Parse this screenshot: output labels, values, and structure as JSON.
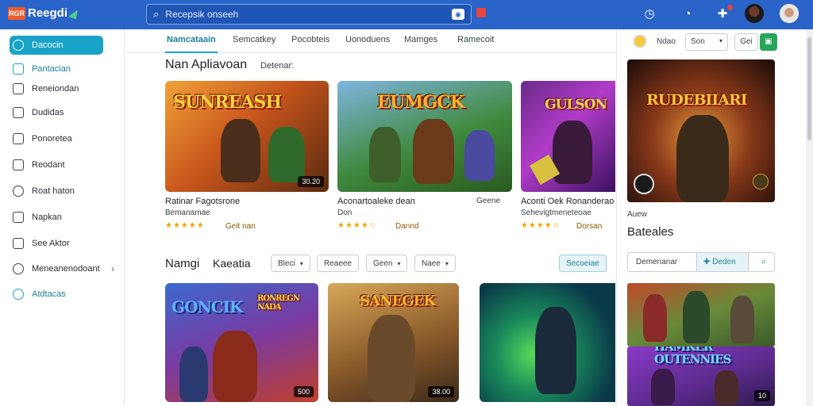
{
  "app": {
    "logo_mark": "RGR",
    "logo_text": "Reegdi"
  },
  "search": {
    "placeholder": "Recepsik onseeh"
  },
  "sidebar": {
    "items": [
      {
        "label": "Dacocin",
        "icon": "compass-icon"
      },
      {
        "label": "Pantacian",
        "icon": "grid-icon"
      },
      {
        "label": "Reneiondan",
        "icon": "document-icon"
      },
      {
        "label": "Dudidas",
        "icon": "list-icon"
      },
      {
        "label": "Ponoretea",
        "icon": "folder-icon"
      },
      {
        "label": "Reodant",
        "icon": "bookmark-icon"
      },
      {
        "label": "Roat haton",
        "icon": "settings-icon"
      },
      {
        "label": "Napkan",
        "icon": "edit-icon"
      },
      {
        "label": "See Aktor",
        "icon": "share-icon"
      },
      {
        "label": "Meneanenodoant",
        "icon": "search-icon"
      },
      {
        "label": "Atdtacas",
        "icon": "refresh-icon"
      }
    ]
  },
  "tabs": [
    "Namcataain",
    "Semcatkey",
    "Pocobteis",
    "Uonoduens",
    "Mamges",
    "Ramecoit"
  ],
  "section1": {
    "title": "Nan Apliavoan",
    "subtitle": "Detenar:",
    "cards": [
      {
        "art": "SUNREASH",
        "price": "30.20",
        "name": "Ratinar Fagotsrone",
        "dev": "Bemanamae",
        "stars": "★★★★★",
        "rating_label": "Geit nan"
      },
      {
        "art": "EUMGCK",
        "price": "",
        "name": "Aconartoaleke dean",
        "dev": "Don",
        "extra": "Geene",
        "stars": "★★★★☆",
        "rating_label": "Dannd"
      },
      {
        "art": "GULSON",
        "price": "",
        "name": "Aconti Oek Ronanderao",
        "dev": "Sehevigtmeneteoae",
        "stars": "★★★★☆",
        "rating_label": "Dorsan"
      }
    ]
  },
  "section2": {
    "title": "Namgi",
    "subtitle": "Kaeatia",
    "filters": [
      {
        "label": "Bleci",
        "dropdown": true
      },
      {
        "label": "Reaeee",
        "dropdown": false
      },
      {
        "label": "Geen",
        "dropdown": true
      },
      {
        "label": "Naee",
        "dropdown": true
      }
    ],
    "action": "Secoeiae",
    "cards": [
      {
        "art": "GONCIK",
        "art2": "RONREGN NADA",
        "price": "500"
      },
      {
        "art": "SANEGEK",
        "price": "38.00"
      },
      {
        "art": "",
        "price": ""
      }
    ]
  },
  "right_panel": {
    "header_label": "Ndao",
    "select_label": "Son",
    "button_label": "Gei",
    "hero_art": "RUDEBIIARI",
    "small_label": "Auew",
    "title": "Bateales",
    "action1": "Demenanar",
    "action2": "Deden",
    "bottom_card_art": "HAMKER OUTENNIES",
    "bottom_card_price": "10"
  },
  "colors": {
    "topbar": "#2a64c8",
    "accent": "#1aa3c8",
    "star": "#f2a500",
    "green": "#27a55a"
  }
}
